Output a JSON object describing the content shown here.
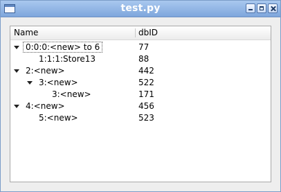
{
  "window": {
    "title": "test.py"
  },
  "tree": {
    "columns": [
      "Name",
      "dbID"
    ],
    "rows": [
      {
        "name": "0:0:0:<new> to 6",
        "dbid": "77"
      },
      {
        "name": "1:1:1:Store13",
        "dbid": "88"
      },
      {
        "name": "2:<new>",
        "dbid": "442"
      },
      {
        "name": "3:<new>",
        "dbid": "522"
      },
      {
        "name": "3:<new>",
        "dbid": "171"
      },
      {
        "name": "4:<new>",
        "dbid": "456"
      },
      {
        "name": "5:<new>",
        "dbid": "523"
      }
    ]
  }
}
